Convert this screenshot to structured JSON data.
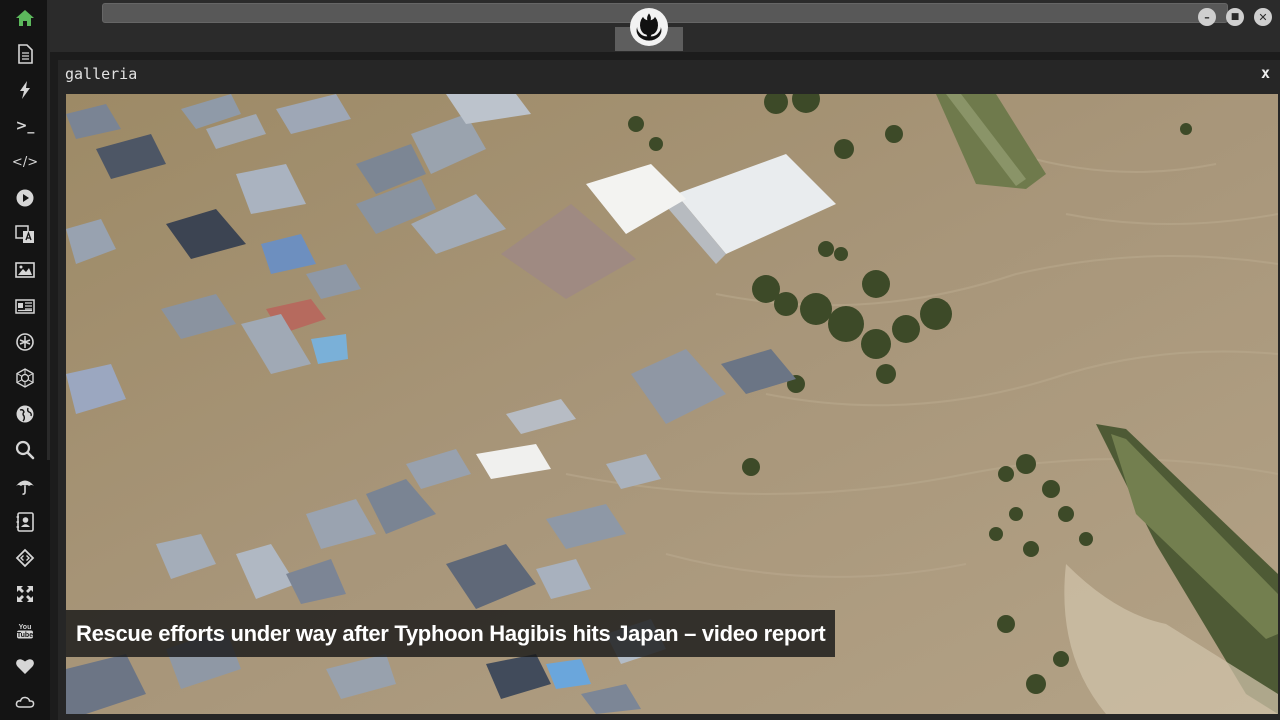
{
  "sidebar": {
    "items": [
      {
        "name": "home-icon",
        "active": true
      },
      {
        "name": "document-icon"
      },
      {
        "name": "lightning-icon"
      },
      {
        "name": "terminal-icon",
        "glyph": ">_"
      },
      {
        "name": "code-icon",
        "glyph": "</>"
      },
      {
        "name": "play-icon"
      },
      {
        "name": "translate-icon"
      },
      {
        "name": "image-icon"
      },
      {
        "name": "newspaper-icon"
      },
      {
        "name": "rebel-alliance-icon"
      },
      {
        "name": "galactic-empire-icon"
      },
      {
        "name": "globe-icon"
      },
      {
        "name": "search-icon"
      },
      {
        "name": "umbrella-icon"
      },
      {
        "name": "contact-card-icon"
      },
      {
        "name": "code-brackets-icon"
      },
      {
        "name": "expand-icon"
      },
      {
        "name": "youtube-icon"
      },
      {
        "name": "heart-icon"
      },
      {
        "name": "cloud-icon"
      }
    ]
  },
  "topbar": {
    "logo": "rebel-alliance-icon",
    "window_buttons": [
      "minimize-icon",
      "maximize-icon",
      "close-icon"
    ]
  },
  "gallery": {
    "title": "galleria",
    "close_label": "x",
    "caption": "Rescue efforts under way after Typhoon Hagibis hits Japan – video report"
  },
  "colors": {
    "accent": "#5cb85c",
    "background": "#1c1c1c",
    "sidebar": "#141414",
    "floodwater": "#a08f6d"
  }
}
